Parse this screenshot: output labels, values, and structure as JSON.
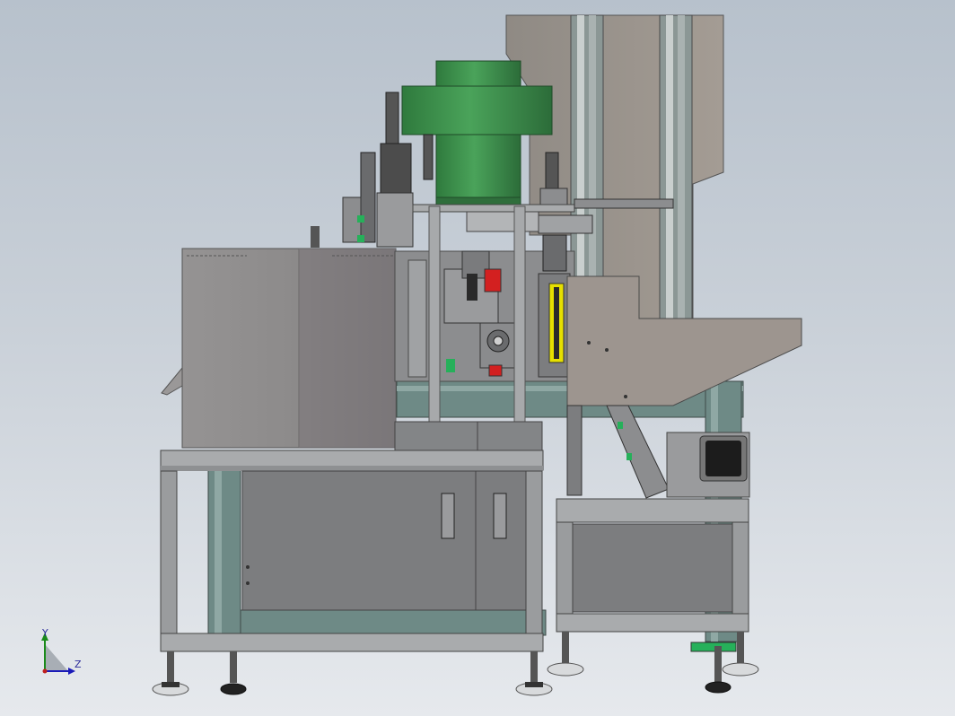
{
  "viewport": {
    "background": "gradient-grey-blue"
  },
  "colors": {
    "frame_grey": "#8e9092",
    "frame_light": "#a9abad",
    "extrusion_teal": "#6e8a86",
    "hopper_green": "#3f9450",
    "hopper_dark": "#2f6e3c",
    "tank_grey": "#8a8888",
    "panel_grey": "#7c7d7f",
    "accent_red": "#d32020",
    "accent_yellow": "#e6e000",
    "accent_green": "#26b05a"
  },
  "triad": {
    "axis_y_label": "Y",
    "axis_z_label": "Z",
    "icon": "coordinate-triad-icon"
  }
}
